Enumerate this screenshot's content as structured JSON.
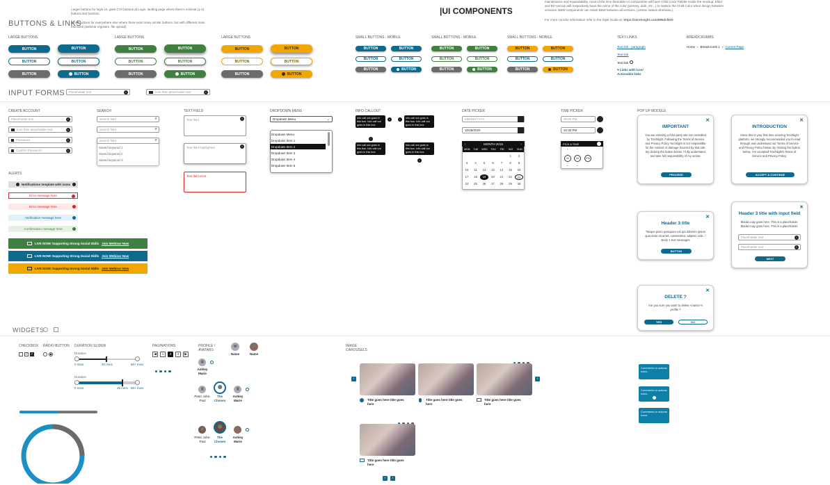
{
  "header": {
    "title": "BUTTONS & LINKS",
    "intro1": "Larger buttons for login UI, giant CTA buttons at Login, landing page where there's minimal (1-2) buttons and function.",
    "intro2": "Small buttons for everywhere else where there exist many similar buttons, but with different main functions (webinar registers, file upload)",
    "ui_title": "UI COMPONENTS",
    "ui_desc": "maintenance and expandability, most of the time themable UI components will have Child Color Palette inside the mockup. Elder and BH version will respectively have the name of the color (primary, dark, etc...) to replace the Child Color when design between versions. B&W components can retain B&W between all versions. (Unless stated otherwise.)",
    "ui_link_pre": "For more concise information refer to the Style Guide at:",
    "ui_link": "https://zeroheight.com/585dcf620"
  },
  "sections": {
    "large1": "LARGE BUTTONS",
    "large2": "LARGE BUTTONS",
    "large3": "LARGE BUTTONS",
    "small1": "SMALL BUTTONS - MOBILE",
    "small2": "SMALL BUTTONS - MOBILE",
    "small3": "SMALL BUTTONS - MOBILE",
    "textlinks": "TEXT LINKS",
    "breadcrumbs": "BREADCRUMBS",
    "input_forms": "INPUT FORMS",
    "create_account": "CREATE ACCOUNT",
    "search": "SEARCH",
    "text_field": "TEXT FIELD",
    "dropdown": "DROPDOWN MENU",
    "info_callout": "INFO CALLOUT",
    "date_picker": "DATE PICKER",
    "time_picker": "TIME PICKER",
    "popup": "POP UP MODULE",
    "alerts": "ALERTS",
    "widgets": "WIDGETS",
    "checkbox": "CHECKBOX",
    "radio": "RADIO BUTTON",
    "duration": "DURATION SLIDER",
    "pagination": "PAGINATIONS",
    "profile": "PROFILE / AVATARS",
    "carousel": "IMAGE CAROUSELS"
  },
  "btn": {
    "label": "BUTTON"
  },
  "links": {
    "l1": "Text link - paragraph",
    "l2": "Text link",
    "l3": "Text link",
    "l4": "Links with icon/ Actionable links"
  },
  "breadcrumb": {
    "home": "Home",
    "b1": "Breadcrumb 1",
    "current": "Current Page"
  },
  "forms": {
    "placeholder": "Placeholder text",
    "icon_placeholder": "Icon then placeholder text"
  },
  "create": {
    "f1": "Placeholder text",
    "f2": "Icon then placeholder text",
    "f3": "Password",
    "f4": "Confirm Password"
  },
  "search": {
    "f1": "Search field",
    "f2": "Search field",
    "f3": "Search field",
    "k1": "Saved keyword 1",
    "k2": "Saved keyword 2",
    "k3": "Saved keyword 3"
  },
  "textfield": {
    "t1": "Text field",
    "t2": "Text field highlighted",
    "t3": "Text field error"
  },
  "dropdown": {
    "head": "Dropdown Menu",
    "items": [
      "Dropdown Menu",
      "Dropdown Item 1",
      "Dropdown Item 2",
      "Dropdown Item 3",
      "Dropdown Item 4",
      "Dropdown Item 5"
    ]
  },
  "callout": {
    "text": "Info call out goes in this box. Info call out goes in this box."
  },
  "date": {
    "f1": "MM/DD/YYYY",
    "f2": "10/28/2020",
    "month": "MONTH 2019",
    "days": [
      "MON",
      "TUE",
      "WED",
      "THU",
      "FRI",
      "SAT",
      "SUN"
    ],
    "grid": [
      [
        "",
        "",
        "",
        "",
        "",
        "1",
        "2"
      ],
      [
        "3",
        "4",
        "5",
        "6",
        "7",
        "8",
        "9"
      ],
      [
        "10",
        "11",
        "12",
        "13",
        "14",
        "15",
        "16"
      ],
      [
        "17",
        "18",
        "19",
        "20",
        "21",
        "22",
        "23"
      ],
      [
        "24",
        "25",
        "26",
        "27",
        "28",
        "29",
        "30"
      ]
    ]
  },
  "time": {
    "f1": "00:00 PM",
    "f2": "10:30 PM",
    "pick": "PICK A TIME",
    "hh": "00",
    "mm": "00",
    "ampm": "PM"
  },
  "alerts": {
    "a1": "Notifications template with icons",
    "a2": "Error message here",
    "a3": "Error message here",
    "a4": "Verification message here",
    "a5": "Confirmation message here",
    "banner": "LIVE NOW! Supporting Strong Social Skills",
    "banner_link": "Join Webinar Now"
  },
  "popups": {
    "p1_title": "IMPORTANT",
    "p1_body": "You are entering a third party site not controlled by Torchlight. Following the Terms of Service and Privacy Policy Torchlight is not responsible for the content or damage incurred by that site. By clicking the button below, I fully understand and take full responsibility of my action.",
    "p1_btn": "PROCEED",
    "p2_title": "INTRODUCTION",
    "p2_body": "Since this is your first time entering Torchlight platform, we strongly recommended you to read through and understand our Terms of Service and Privacy Policy below. By clicking the button below, I've accepted Torchlight's Terms of Service and Privacy Policy.",
    "p2_btn": "ACCEPT & CONTINUE",
    "p3_title": "Header 3 title",
    "p3_body": "\"Neque porro quisquam est qui dolorem ipsum quia dolor sit amet, consectetur, adipisci velit...\" Body 1 text messages",
    "p3_btn": "BUTTON",
    "p4_title": "Header 3 title with input field",
    "p4_body": "Modal copy goes here. This is a placeholder. Modal copy goes here. This is a placeholder.",
    "p4_f1": "Placeholder text",
    "p4_f2": "Placeholder text",
    "p4_btn": "NEXT",
    "p5_title": "DELETE ?",
    "p5_body": "Are you sure you want to delete <name>'s profile ?",
    "p5_yes": "YES",
    "p5_no": "NO"
  },
  "slider": {
    "label": "Duration",
    "v1": "0 mins",
    "v2": "30 mins",
    "v3": "60+ mins",
    "w1": "0 mins",
    "w2": "45 mins",
    "w3": "60+ mins"
  },
  "pagination": {
    "p1": "1",
    "p2": "2",
    "p3": "3"
  },
  "profiles": {
    "name": "Name",
    "ashley": "Ashley Marie",
    "peter": "Peter John-Paul",
    "chosen": "The Chosen"
  },
  "carousel": {
    "caption": "Title goes here title goes here"
  },
  "tooltips": {
    "t": "Comments or actions icons"
  },
  "colors": {
    "blue": "#0e6a8c",
    "green": "#3f7f3f",
    "orange": "#f2a600",
    "grey": "#6b6b6b"
  }
}
